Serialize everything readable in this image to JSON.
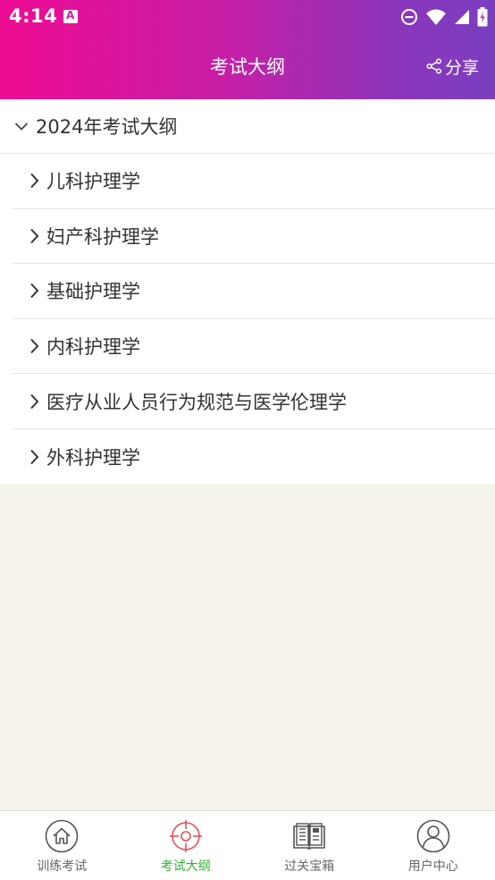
{
  "status_bar": {
    "time": "4:14"
  },
  "header": {
    "title": "考试大纲",
    "share_label": "分享"
  },
  "outline": {
    "root_label": "2024年考试大纲",
    "items": [
      {
        "label": "儿科护理学"
      },
      {
        "label": "妇产科护理学"
      },
      {
        "label": "基础护理学"
      },
      {
        "label": "内科护理学"
      },
      {
        "label": "医疗从业人员行为规范与医学伦理学"
      },
      {
        "label": "外科护理学"
      }
    ]
  },
  "tabbar": {
    "tabs": [
      {
        "label": "训练考试",
        "icon": "home-icon"
      },
      {
        "label": "考试大纲",
        "icon": "target-icon",
        "active": true
      },
      {
        "label": "过关宝箱",
        "icon": "book-icon"
      },
      {
        "label": "用户中心",
        "icon": "user-icon"
      }
    ]
  },
  "colors": {
    "header_gradient_start": "#ee0c93",
    "header_gradient_end": "#7a3ec1",
    "active_tab_text": "#2db52f",
    "active_tab_icon": "#e8505b",
    "background": "#f6f3ec"
  }
}
